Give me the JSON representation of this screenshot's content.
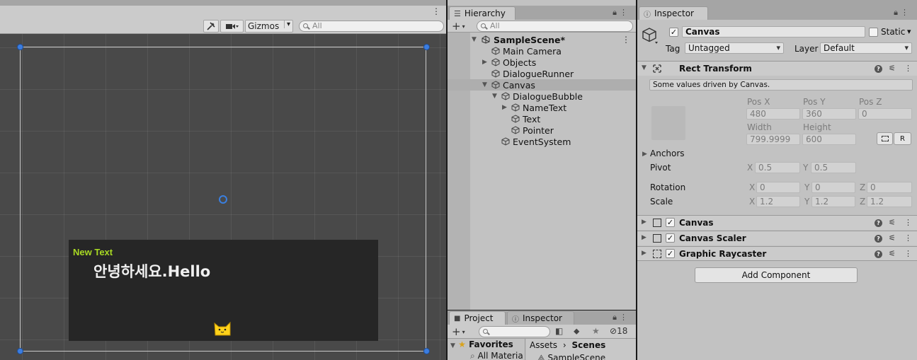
{
  "scene": {
    "toolbar": {
      "gizmos_label": "Gizmos",
      "search_placeholder": "All"
    },
    "canvas": {
      "name_text": "New Text",
      "body_text": "안녕하세요.Hello"
    }
  },
  "hierarchy": {
    "tab_label": "Hierarchy",
    "search_placeholder": "All",
    "items": [
      {
        "label": "SampleScene*"
      },
      {
        "label": "Main Camera"
      },
      {
        "label": "Objects"
      },
      {
        "label": "DialogueRunner"
      },
      {
        "label": "Canvas"
      },
      {
        "label": "DialogueBubble"
      },
      {
        "label": "NameText"
      },
      {
        "label": "Text"
      },
      {
        "label": "Pointer"
      },
      {
        "label": "EventSystem"
      }
    ]
  },
  "project": {
    "tabs": [
      {
        "label": "Project"
      },
      {
        "label": "Inspector"
      }
    ],
    "hidden_count": "18",
    "favorites_label": "Favorites",
    "favorites_item": "All Materia",
    "breadcrumb": [
      "Assets",
      "Scenes"
    ],
    "scene_item": "SampleScene"
  },
  "inspector": {
    "tab_label": "Inspector",
    "object_name": "Canvas",
    "static_label": "Static",
    "tag_label": "Tag",
    "tag_value": "Untagged",
    "layer_label": "Layer",
    "layer_value": "Default",
    "rect_transform": {
      "title": "Rect Transform",
      "note": "Some values driven by Canvas.",
      "pos_x_label": "Pos X",
      "pos_y_label": "Pos Y",
      "pos_z_label": "Pos Z",
      "pos_x": "480",
      "pos_y": "360",
      "pos_z": "0",
      "width_label": "Width",
      "height_label": "Height",
      "width": "799.9999",
      "height": "600",
      "r_button": "R",
      "anchors_label": "Anchors",
      "pivot_label": "Pivot",
      "pivot_x": "0.5",
      "pivot_y": "0.5",
      "rotation_label": "Rotation",
      "rot_x": "0",
      "rot_y": "0",
      "rot_z": "0",
      "scale_label": "Scale",
      "scale_x": "1.2",
      "scale_y": "1.2",
      "scale_z": "1.2",
      "x": "X",
      "y": "Y",
      "z": "Z"
    },
    "components": [
      {
        "title": "Canvas"
      },
      {
        "title": "Canvas Scaler"
      },
      {
        "title": "Graphic Raycaster"
      }
    ],
    "add_component": "Add Component"
  },
  "colors": {
    "accent": "#3b7de0",
    "name_text": "#a8d923",
    "scene_bg": "#494949",
    "bubble_bg": "#262626"
  }
}
